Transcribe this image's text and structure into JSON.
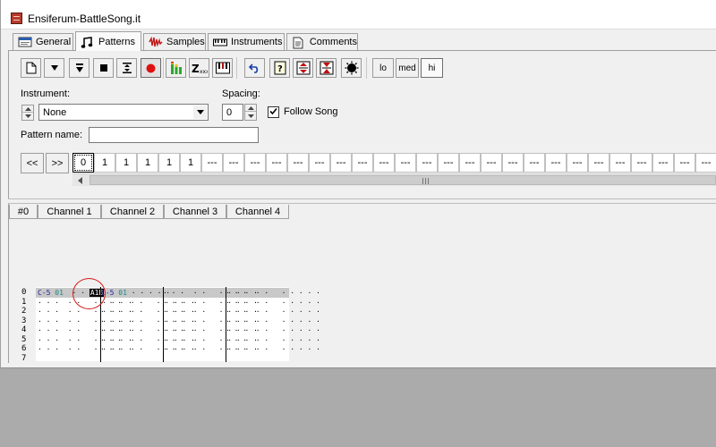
{
  "window": {
    "title": "Ensiferum-BattleSong.it"
  },
  "tabs": [
    {
      "label": "General",
      "icon": "general-icon"
    },
    {
      "label": "Patterns",
      "icon": "music-note-icon",
      "active": true
    },
    {
      "label": "Samples",
      "icon": "waveform-icon"
    },
    {
      "label": "Instruments",
      "icon": "piano-icon"
    },
    {
      "label": "Comments",
      "icon": "document-icon"
    }
  ],
  "toolbar": {
    "buttons": [
      "new-pattern-icon",
      "play-pattern-icon",
      "play-from-start-icon",
      "stop-icon",
      "play-row-icon",
      "record-icon",
      "vu-meter-icon",
      "zoom-text-icon",
      "keyboard-icon",
      "undo-icon",
      "properties-icon",
      "expand-icon",
      "shrink-icon",
      "sample-icon"
    ],
    "levels": [
      "lo",
      "med",
      "hi"
    ],
    "level_selected": "hi"
  },
  "instrument": {
    "label": "Instrument:",
    "value": "None"
  },
  "spacing": {
    "label": "Spacing:",
    "value": "0"
  },
  "follow_song": {
    "label": "Follow Song",
    "checked": true
  },
  "pattern_name": {
    "label": "Pattern name:",
    "value": ""
  },
  "order_nav": {
    "prev": "<<",
    "next": ">>"
  },
  "orders": [
    "0",
    "1",
    "1",
    "1",
    "1",
    "1",
    "---",
    "---",
    "---",
    "---",
    "---",
    "---",
    "---",
    "---",
    "---",
    "---",
    "---",
    "---",
    "---",
    "---",
    "---",
    "---",
    "---",
    "---",
    "---",
    "---",
    "---",
    "---",
    "---",
    "---"
  ],
  "pattern": {
    "number": "#0",
    "channels": [
      "Channel 1",
      "Channel 2",
      "Channel 3",
      "Channel 4"
    ],
    "row_numbers": [
      "0",
      "1",
      "2",
      "3",
      "4",
      "5",
      "6",
      "7"
    ],
    "current_row": {
      "ch1_note": "C-5",
      "ch1_inst": "01",
      "ch1_cmd": "A1B",
      "ch2_note": "C-5",
      "ch2_inst": "01",
      "ch2_rest": "· · · · ·",
      "ch3": "· · ·  · ·   · · · · ·",
      "ch4": "· · ·  · ·   · · · · ·"
    },
    "empty_cell": "· · ·  · ·   · · · · ·"
  }
}
